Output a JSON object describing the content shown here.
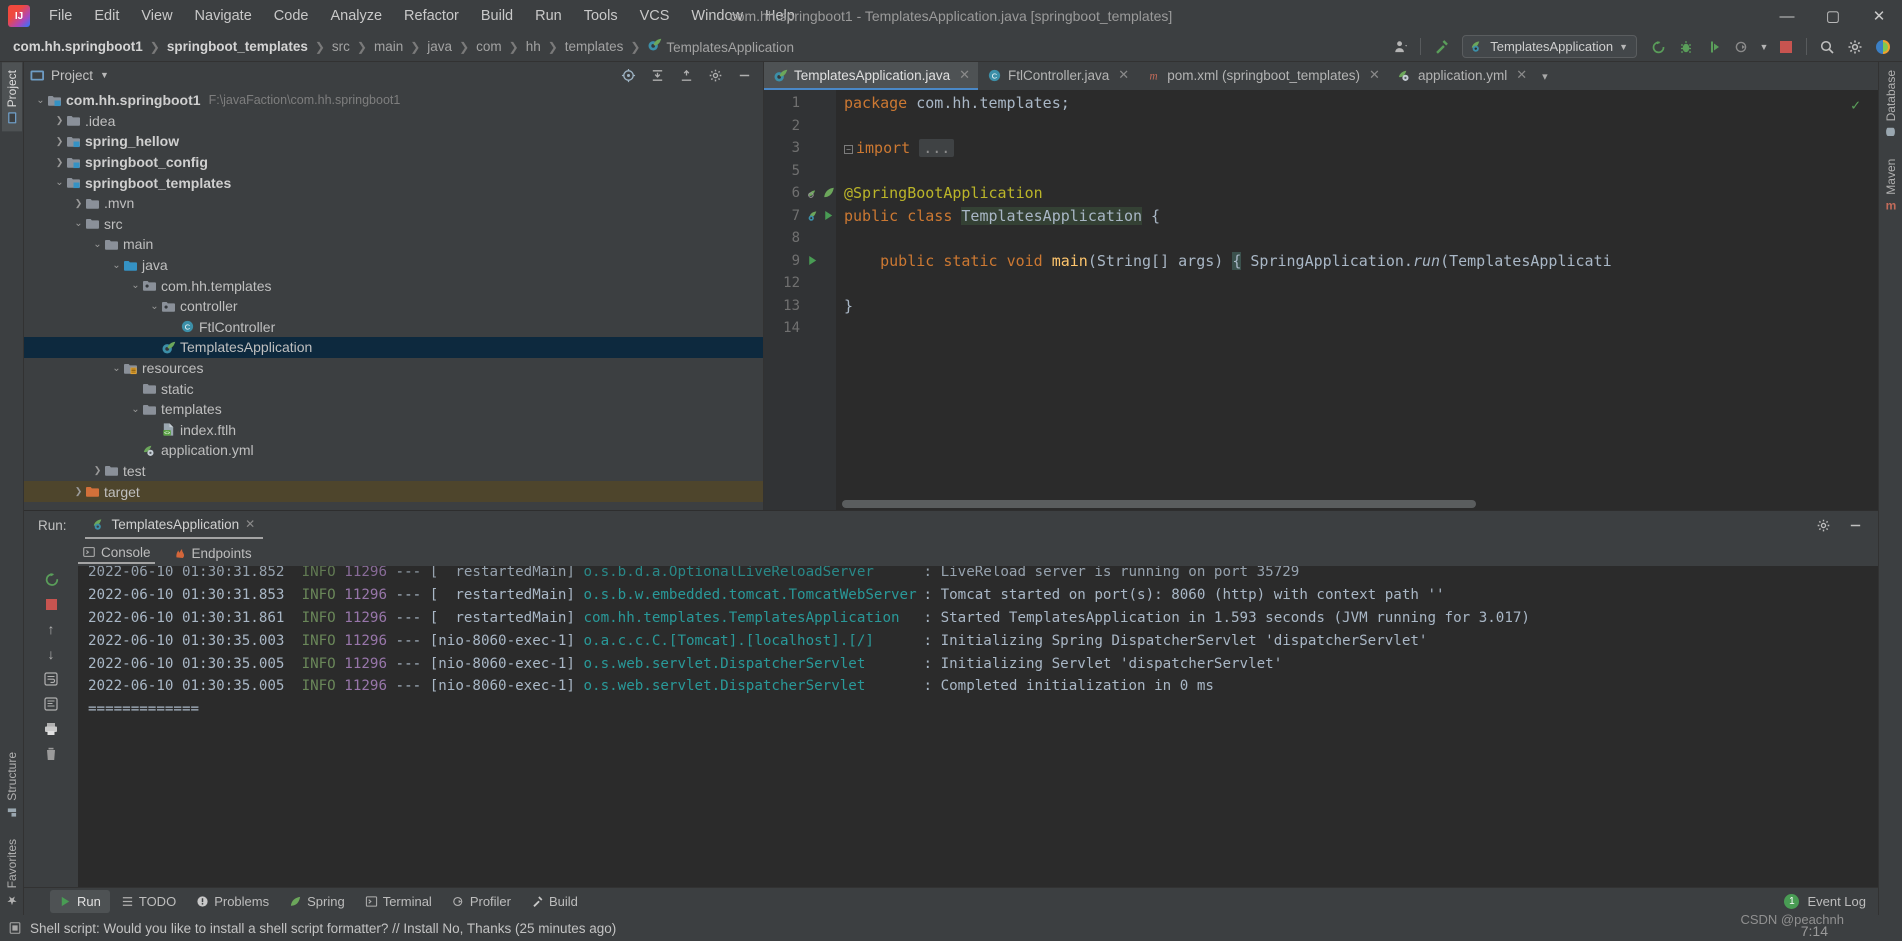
{
  "window": {
    "title": "com.hh.springboot1 - TemplatesApplication.java [springboot_templates]",
    "minimize": "—",
    "maximize": "▢",
    "close": "✕"
  },
  "menubar": {
    "items": [
      "File",
      "Edit",
      "View",
      "Navigate",
      "Code",
      "Analyze",
      "Refactor",
      "Build",
      "Run",
      "Tools",
      "VCS",
      "Window",
      "Help"
    ]
  },
  "breadcrumbs": [
    {
      "label": "com.hh.springboot1",
      "bold": true
    },
    {
      "label": "springboot_templates",
      "bold": true
    },
    {
      "label": "src",
      "bold": false
    },
    {
      "label": "main",
      "bold": false
    },
    {
      "label": "java",
      "bold": false
    },
    {
      "label": "com",
      "bold": false
    },
    {
      "label": "hh",
      "bold": false
    },
    {
      "label": "templates",
      "bold": false
    },
    {
      "label": "TemplatesApplication",
      "bold": false,
      "icon": "spring-class-icon"
    }
  ],
  "toolbar": {
    "run_config": "TemplatesApplication",
    "icons": [
      "user-icon",
      "chevron-down-icon",
      "build-hammer-icon",
      "run-icon",
      "debug-icon",
      "run-coverage-icon",
      "profile-icon",
      "chevron-down-icon",
      "stop-icon",
      "search-icon",
      "gear-icon",
      "ide-plugin-icon"
    ]
  },
  "left_strip": {
    "top": [
      {
        "label": "Project",
        "icon": "project-icon",
        "active": true
      }
    ],
    "bottom": [
      {
        "label": "Structure",
        "icon": "structure-icon"
      },
      {
        "label": "Favorites",
        "icon": "star-icon"
      }
    ]
  },
  "right_strip": {
    "items": [
      {
        "label": "Database",
        "icon": "database-icon"
      },
      {
        "label": "Maven",
        "icon": "maven-icon"
      }
    ]
  },
  "project_panel": {
    "title": "Project",
    "header_icons": [
      "target-icon",
      "collapse-icon",
      "expand-icon",
      "gear-icon",
      "hide-icon"
    ],
    "tree": [
      {
        "depth": 0,
        "arrow": "down",
        "icon": "module-folder",
        "label": "com.hh.springboot1",
        "bold": true,
        "path": "F:\\javaFaction\\com.hh.springboot1"
      },
      {
        "depth": 1,
        "arrow": "right",
        "icon": "folder",
        "label": ".idea",
        "bold": false
      },
      {
        "depth": 1,
        "arrow": "right",
        "icon": "module-folder",
        "label": "spring_hellow",
        "bold": true
      },
      {
        "depth": 1,
        "arrow": "right",
        "icon": "module-folder",
        "label": "springboot_config",
        "bold": true
      },
      {
        "depth": 1,
        "arrow": "down",
        "icon": "module-folder",
        "label": "springboot_templates",
        "bold": true
      },
      {
        "depth": 2,
        "arrow": "right",
        "icon": "folder",
        "label": ".mvn",
        "bold": false
      },
      {
        "depth": 2,
        "arrow": "down",
        "icon": "folder",
        "label": "src",
        "bold": false
      },
      {
        "depth": 3,
        "arrow": "down",
        "icon": "folder",
        "label": "main",
        "bold": false
      },
      {
        "depth": 4,
        "arrow": "down",
        "icon": "source-folder",
        "label": "java",
        "bold": false
      },
      {
        "depth": 5,
        "arrow": "down",
        "icon": "package",
        "label": "com.hh.templates",
        "bold": false
      },
      {
        "depth": 6,
        "arrow": "down",
        "icon": "package",
        "label": "controller",
        "bold": false
      },
      {
        "depth": 7,
        "arrow": "none",
        "icon": "class-icon",
        "label": "FtlController",
        "bold": false
      },
      {
        "depth": 6,
        "arrow": "none",
        "icon": "spring-class-icon",
        "label": "TemplatesApplication",
        "bold": false,
        "selected": true
      },
      {
        "depth": 4,
        "arrow": "down",
        "icon": "resources-folder",
        "label": "resources",
        "bold": false
      },
      {
        "depth": 5,
        "arrow": "none",
        "icon": "folder",
        "label": "static",
        "bold": false
      },
      {
        "depth": 5,
        "arrow": "down",
        "icon": "folder",
        "label": "templates",
        "bold": false
      },
      {
        "depth": 6,
        "arrow": "none",
        "icon": "ftl-file-icon",
        "label": "index.ftlh",
        "bold": false
      },
      {
        "depth": 5,
        "arrow": "none",
        "icon": "spring-yml-icon",
        "label": "application.yml",
        "bold": false
      },
      {
        "depth": 3,
        "arrow": "right",
        "icon": "folder",
        "label": "test",
        "bold": false
      },
      {
        "depth": 2,
        "arrow": "right",
        "icon": "excluded-folder",
        "label": "target",
        "bold": false,
        "excluded": true
      }
    ]
  },
  "editor": {
    "tabs": [
      {
        "label": "TemplatesApplication.java",
        "icon": "spring-class-icon",
        "active": true,
        "close": "✕"
      },
      {
        "label": "FtlController.java",
        "icon": "class-icon",
        "active": false,
        "close": "✕"
      },
      {
        "label": "pom.xml (springboot_templates)",
        "icon": "maven-icon",
        "active": false,
        "close": "✕"
      },
      {
        "label": "application.yml",
        "icon": "spring-yml-icon",
        "active": false,
        "close": "✕"
      }
    ],
    "tab_overflow": "▾",
    "inspection_status": "✓",
    "lines": [
      {
        "n": "1",
        "segments": [
          {
            "t": "package ",
            "c": "kw"
          },
          {
            "t": "com.hh.templates;",
            "c": "pl"
          }
        ]
      },
      {
        "n": "2",
        "segments": []
      },
      {
        "n": "3",
        "segments": [
          {
            "t": "fold"
          },
          {
            "t": "import ",
            "c": "kw"
          },
          {
            "t": "...",
            "c": "fold-text"
          }
        ]
      },
      {
        "n": "5",
        "segments": []
      },
      {
        "n": "6",
        "segments": [
          {
            "t": "@SpringBootApplication",
            "c": "anno"
          }
        ],
        "gutter": [
          "bean-icon",
          "spring-leaf-icon"
        ]
      },
      {
        "n": "7",
        "segments": [
          {
            "t": "public ",
            "c": "kw"
          },
          {
            "t": "class ",
            "c": "kw"
          },
          {
            "t": "TemplatesApplication",
            "c": "hl-ident"
          },
          {
            "t": " {",
            "c": "pl"
          }
        ],
        "gutter": [
          "spring-bean-icon",
          "run-green-icon"
        ]
      },
      {
        "n": "8",
        "segments": []
      },
      {
        "n": "9",
        "segments": [
          {
            "t": "    public ",
            "c": "kw"
          },
          {
            "t": "static ",
            "c": "kw"
          },
          {
            "t": "void ",
            "c": "kw"
          },
          {
            "t": "main",
            "c": "fn"
          },
          {
            "t": "(String[] args) ",
            "c": "pl"
          },
          {
            "t": "{",
            "c": "hl-brace"
          },
          {
            "t": " SpringApplication.",
            "c": "pl"
          },
          {
            "t": "run",
            "c": "italic-pl"
          },
          {
            "t": "(TemplatesApplicati",
            "c": "pl"
          }
        ],
        "gutter": [
          "run-green-icon",
          "fold2"
        ]
      },
      {
        "n": "12",
        "segments": []
      },
      {
        "n": "13",
        "segments": [
          {
            "t": "}",
            "c": "pl"
          }
        ]
      },
      {
        "n": "14",
        "segments": []
      }
    ]
  },
  "run_panel": {
    "label": "Run:",
    "tab": "TemplatesApplication",
    "tab_close": "✕",
    "header_icons": [
      "gear-icon",
      "hide-icon"
    ],
    "console_tabs": [
      {
        "label": "Console",
        "icon": "console-icon",
        "active": true
      },
      {
        "label": "Endpoints",
        "icon": "endpoints-icon",
        "active": false
      }
    ],
    "gutter_icons": [
      "rerun-icon",
      "up-icon",
      "down-icon",
      "soft-wrap-icon",
      "scroll-end-icon",
      "print-icon",
      "trash-icon"
    ],
    "log": [
      {
        "ts": "2022-06-10 01:30:31.852",
        "lvl": "INFO",
        "pid": "11296",
        "thread": "[  restartedMain]",
        "logger": "o.s.b.d.a.OptionalLiveReloadServer",
        "msg": ": LiveReload server is running on port 35729",
        "cut": true
      },
      {
        "ts": "2022-06-10 01:30:31.853",
        "lvl": "INFO",
        "pid": "11296",
        "thread": "[  restartedMain]",
        "logger": "o.s.b.w.embedded.tomcat.TomcatWebServer",
        "msg": ": Tomcat started on port(s): 8060 (http) with context path ''"
      },
      {
        "ts": "2022-06-10 01:30:31.861",
        "lvl": "INFO",
        "pid": "11296",
        "thread": "[  restartedMain]",
        "logger": "com.hh.templates.TemplatesApplication",
        "msg": ": Started TemplatesApplication in 1.593 seconds (JVM running for 3.017)"
      },
      {
        "ts": "2022-06-10 01:30:35.003",
        "lvl": "INFO",
        "pid": "11296",
        "thread": "[nio-8060-exec-1]",
        "logger": "o.a.c.c.C.[Tomcat].[localhost].[/]",
        "msg": ": Initializing Spring DispatcherServlet 'dispatcherServlet'"
      },
      {
        "ts": "2022-06-10 01:30:35.005",
        "lvl": "INFO",
        "pid": "11296",
        "thread": "[nio-8060-exec-1]",
        "logger": "o.s.web.servlet.DispatcherServlet",
        "msg": ": Initializing Servlet 'dispatcherServlet'"
      },
      {
        "ts": "2022-06-10 01:30:35.005",
        "lvl": "INFO",
        "pid": "11296",
        "thread": "[nio-8060-exec-1]",
        "logger": "o.s.web.servlet.DispatcherServlet",
        "msg": ": Completed initialization in 0 ms"
      },
      {
        "plain": "============="
      }
    ]
  },
  "status_tabs": {
    "items": [
      {
        "label": "Run",
        "icon": "run-icon",
        "active": true
      },
      {
        "label": "TODO",
        "icon": "todo-icon",
        "active": false
      },
      {
        "label": "Problems",
        "icon": "problems-icon",
        "active": false
      },
      {
        "label": "Spring",
        "icon": "spring-leaf-icon",
        "active": false
      },
      {
        "label": "Terminal",
        "icon": "terminal-icon",
        "active": false
      },
      {
        "label": "Profiler",
        "icon": "profiler-icon",
        "active": false
      },
      {
        "label": "Build",
        "icon": "build-hammer-icon",
        "active": false
      }
    ],
    "event_log": {
      "count": "1",
      "label": "Event Log"
    }
  },
  "status_bar": {
    "message": "Shell script: Would you like to install a shell script formatter? // Install   No, Thanks (25 minutes ago)",
    "icon": "note-icon",
    "watermark": "CSDN @peachnh",
    "watermark2": "7:14"
  },
  "colors": {
    "accent": "#4a88c7",
    "selection": "#0d293e",
    "excluded": "#4e452c",
    "keyword": "#cc7832",
    "annotation": "#bbb529",
    "logger": "#299999",
    "level": "#6a8759",
    "pid": "#9876aa",
    "green": "#499c54",
    "stop_red": "#c75450"
  }
}
